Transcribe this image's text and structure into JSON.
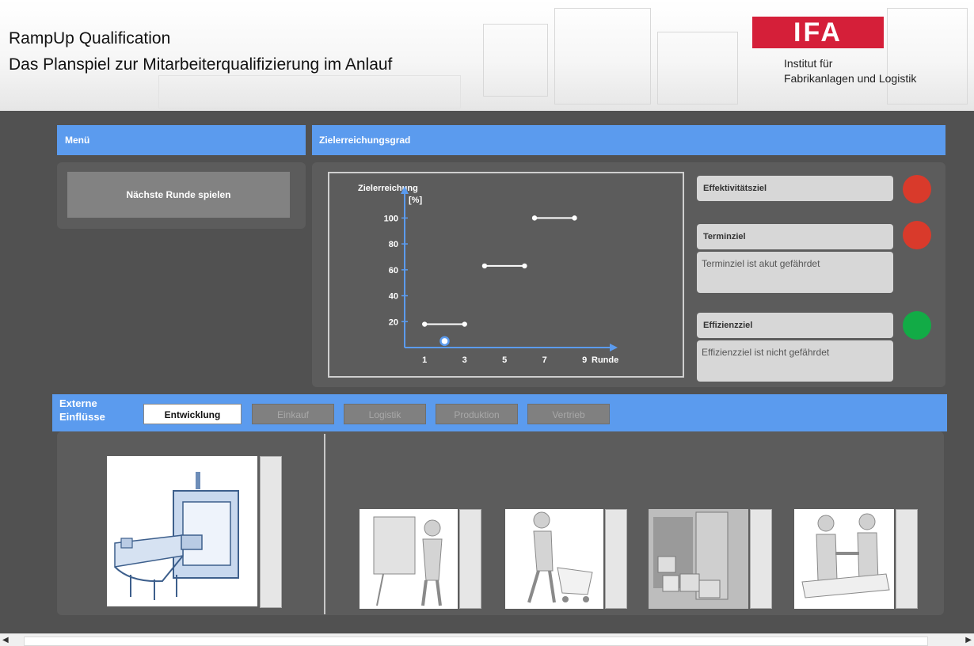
{
  "header": {
    "title": "RampUp Qualification",
    "subtitle": "Das Planspiel zur Mitarbeiterqualifizierung  im Anlauf",
    "logo_text": "IFA",
    "institute_line1": "Institut für",
    "institute_line2": "Fabrikanlagen und Logistik",
    "logo_color": "#d51f39"
  },
  "menu": {
    "title": "Menü",
    "next_round_label": "Nächste Runde spielen"
  },
  "goals": {
    "title": "Zielerreichungsgrad",
    "effectiveness": {
      "label": "Effektivitätsziel",
      "status": "red"
    },
    "deadline": {
      "label": "Terminziel",
      "status": "red",
      "description": "Terminziel ist akut gefährdet"
    },
    "efficiency": {
      "label": "Effizienzziel",
      "status": "green",
      "description": "Effizienzziel ist nicht gefährdet"
    },
    "colors": {
      "red": "#d93a2b",
      "green": "#12ab46"
    }
  },
  "chart_data": {
    "type": "line",
    "ylabel": "Zielerreichung",
    "yunit": "[%]",
    "xlabel": "Runde",
    "x_ticks": [
      1,
      3,
      5,
      7,
      9
    ],
    "y_ticks": [
      20,
      40,
      60,
      80,
      100
    ],
    "xlim": [
      0,
      10.5
    ],
    "ylim": [
      0,
      110
    ],
    "segments": [
      {
        "x": [
          1,
          3
        ],
        "y": [
          18,
          18
        ]
      },
      {
        "x": [
          4,
          6
        ],
        "y": [
          63,
          63
        ]
      },
      {
        "x": [
          6.5,
          8.5
        ],
        "y": [
          100,
          100
        ]
      }
    ],
    "marker": {
      "x": 2,
      "y": 5
    }
  },
  "external": {
    "label": "Externe Einflüsse",
    "tabs": [
      "Entwicklung",
      "Einkauf",
      "Logistik",
      "Produktion",
      "Vertrieb"
    ],
    "active_tab": "Entwicklung",
    "images": [
      "conveyor-machine-image",
      "engineer-at-board-image",
      "shopping-cart-image",
      "warehouse-boxes-image",
      "handshake-image"
    ]
  },
  "accent_color": "#5b9bee"
}
